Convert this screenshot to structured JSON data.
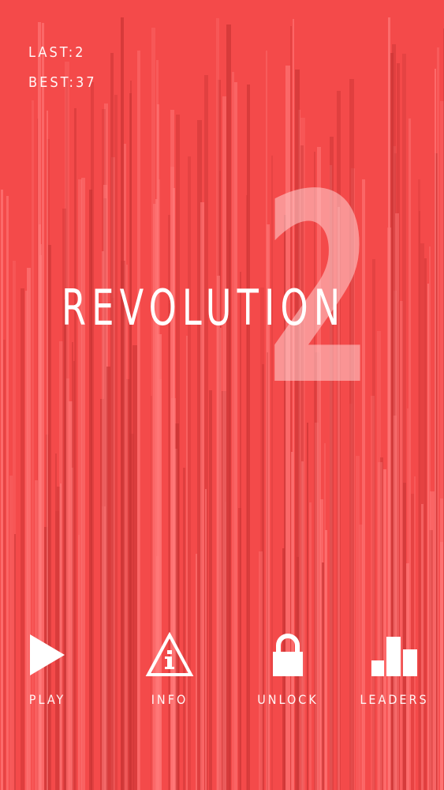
{
  "scores": {
    "last_label": "LAST:",
    "last_value": "2",
    "best_label": "BEST:",
    "best_value": "37"
  },
  "title": {
    "word": "REVOLUTION",
    "number": "2"
  },
  "menu": [
    {
      "id": "play",
      "label": "PLAY",
      "icon": "play-icon"
    },
    {
      "id": "info",
      "label": "INFO",
      "icon": "info-warning-icon"
    },
    {
      "id": "unlock",
      "label": "UNLOCK",
      "icon": "lock-icon"
    },
    {
      "id": "leaders",
      "label": "LEADERS",
      "icon": "bar-chart-icon"
    }
  ],
  "colors": {
    "background": "#f44a4a",
    "stripe_light": "#ff7a7a",
    "stripe_dark": "#c83434",
    "text": "#ffffff"
  }
}
